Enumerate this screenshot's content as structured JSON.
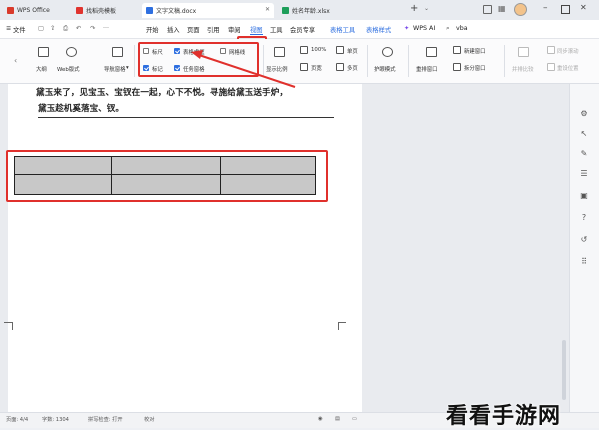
{
  "tabs": [
    {
      "label": "WPS Office",
      "color": "#d93a2b"
    },
    {
      "label": "找稻壳模板",
      "color": "#e0332e"
    },
    {
      "label": "文字文稿.docx",
      "color": "#2e6fe0"
    },
    {
      "label": "姓名年龄.xlsx",
      "color": "#1d9e5a"
    }
  ],
  "menu": {
    "file": "文件",
    "items": [
      "开始",
      "插入",
      "页面",
      "引用",
      "审阅",
      "视图",
      "工具",
      "会员专享"
    ],
    "context": [
      "表格工具",
      "表格样式"
    ],
    "wps_ai": "WPS AI",
    "search": "vba"
  },
  "ribbon": {
    "outline": "大纲",
    "web_layout": "Web版式",
    "nav_pane": "导航窗格",
    "checks": [
      {
        "label": "标尺",
        "checked": false
      },
      {
        "label": "表格虚框",
        "checked": true
      },
      {
        "label": "网格线",
        "checked": false
      },
      {
        "label": "标记",
        "checked": true
      },
      {
        "label": "任务窗格",
        "checked": true
      }
    ],
    "display_ratio": "显示比例",
    "zoom": "100%",
    "page_width": "页宽",
    "single_page": "单页",
    "multi_page": "多页",
    "eye_mode": "护眼模式",
    "rearrange": "重排窗口",
    "new_window": "新建窗口",
    "split_window": "拆分窗口",
    "sync_scroll": "同步滚动",
    "side_by_side": "并排比较",
    "reset_pos": "重设位置"
  },
  "document": {
    "line1": "黛玉来了，见宝玉、宝钗在一起，心下不悦。寻施给黛玉送手炉，",
    "line2": "黛玉趁机奚落宝、钗。",
    "table": {
      "rows": 2,
      "cols": 3
    }
  },
  "status": {
    "page": "页面: 4/4",
    "words": "字数: 1304",
    "spell": "拼写检查: 打开",
    "proof": "校对"
  },
  "watermark": "看看手游网",
  "colors": {
    "highlight": "#e0302c",
    "accent": "#2e6fe0"
  }
}
